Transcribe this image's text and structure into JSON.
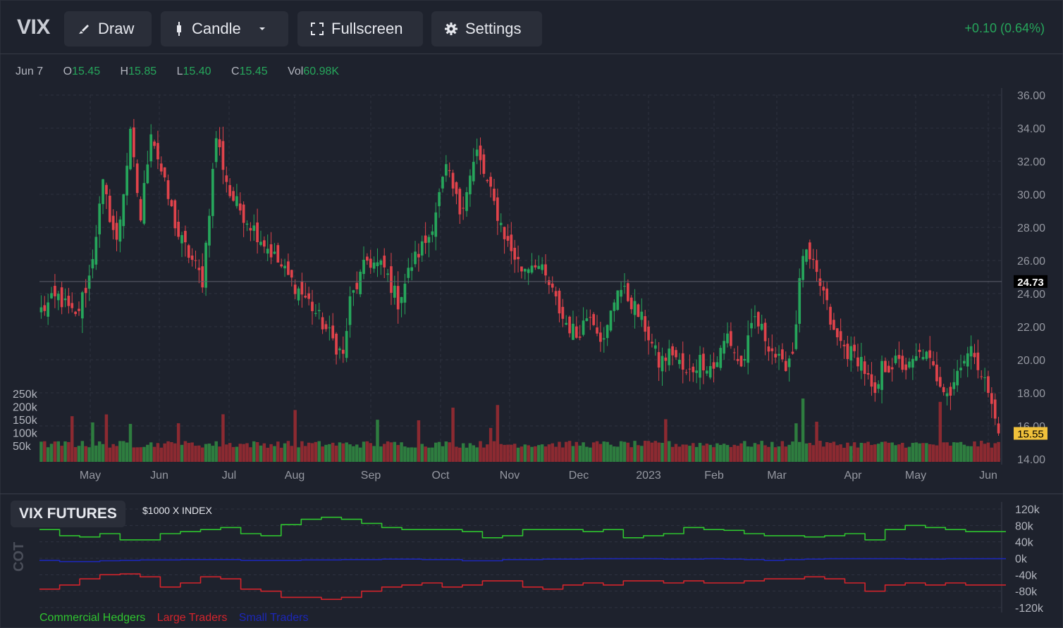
{
  "toolbar": {
    "symbol": "VIX",
    "draw_label": "Draw",
    "candle_label": "Candle",
    "fullscreen_label": "Fullscreen",
    "settings_label": "Settings",
    "change": "+0.10 (0.64%)"
  },
  "ohlc": {
    "date": "Jun 7",
    "open_key": "O",
    "open": "15.45",
    "high_key": "H",
    "high": "15.85",
    "low_key": "L",
    "low": "15.40",
    "close_key": "C",
    "close": "15.45",
    "vol_key": "Vol",
    "vol": "60.98K"
  },
  "colors": {
    "up": "#26a65b",
    "down": "#e0434b",
    "vol_up": "#2e7d3f",
    "vol_down": "#8c2a31",
    "commercial": "#2fc52f",
    "large": "#d3242c",
    "small": "#1c27b8",
    "last_price_bg": "#f0c13b",
    "crosshair_bg": "#000000"
  },
  "chart_data": [
    {
      "type": "candlestick",
      "title": "VIX",
      "x_labels": [
        "May",
        "Jun",
        "Jul",
        "Aug",
        "Sep",
        "Oct",
        "Nov",
        "Dec",
        "2023",
        "Feb",
        "Mar",
        "Apr",
        "May",
        "Jun"
      ],
      "ylim": [
        14,
        36
      ],
      "y_ticks": [
        "36.00",
        "34.00",
        "32.00",
        "30.00",
        "28.00",
        "26.00",
        "24.00",
        "22.00",
        "20.00",
        "18.00",
        "16.00",
        "14.00"
      ],
      "crosshair_value": "24.73",
      "last_price": "15.55",
      "anchors_close": [
        [
          0,
          23.0
        ],
        [
          5,
          23.8
        ],
        [
          10,
          22.5
        ],
        [
          14,
          25.0
        ],
        [
          18,
          30.5
        ],
        [
          22,
          27.0
        ],
        [
          26,
          33.5
        ],
        [
          29,
          28.5
        ],
        [
          32,
          34.0
        ],
        [
          36,
          30.5
        ],
        [
          40,
          27.5
        ],
        [
          44,
          26.0
        ],
        [
          47,
          24.8
        ],
        [
          51,
          33.5
        ],
        [
          55,
          30.0
        ],
        [
          60,
          28.5
        ],
        [
          66,
          26.8
        ],
        [
          72,
          25.0
        ],
        [
          78,
          23.5
        ],
        [
          84,
          21.5
        ],
        [
          88,
          20.2
        ],
        [
          90,
          23.5
        ],
        [
          95,
          26.0
        ],
        [
          100,
          25.5
        ],
        [
          104,
          23.5
        ],
        [
          108,
          25.8
        ],
        [
          113,
          27.5
        ],
        [
          118,
          31.5
        ],
        [
          122,
          29.0
        ],
        [
          127,
          32.5
        ],
        [
          131,
          30.0
        ],
        [
          136,
          27.0
        ],
        [
          140,
          25.5
        ],
        [
          144,
          26.0
        ],
        [
          148,
          24.5
        ],
        [
          152,
          22.5
        ],
        [
          156,
          21.5
        ],
        [
          160,
          23.0
        ],
        [
          164,
          21.0
        ],
        [
          168,
          24.5
        ],
        [
          172,
          23.5
        ],
        [
          176,
          22.0
        ],
        [
          180,
          19.8
        ],
        [
          184,
          20.5
        ],
        [
          188,
          19.0
        ],
        [
          192,
          20.0
        ],
        [
          196,
          19.5
        ],
        [
          200,
          21.5
        ],
        [
          204,
          19.5
        ],
        [
          208,
          22.5
        ],
        [
          212,
          21.0
        ],
        [
          216,
          19.5
        ],
        [
          219,
          20.5
        ],
        [
          222,
          26.5
        ],
        [
          225,
          25.5
        ],
        [
          228,
          24.0
        ],
        [
          231,
          21.5
        ],
        [
          235,
          20.5
        ],
        [
          239,
          20.0
        ],
        [
          243,
          17.5
        ],
        [
          245,
          19.5
        ],
        [
          249,
          19.8
        ],
        [
          253,
          19.5
        ],
        [
          257,
          20.5
        ],
        [
          261,
          19.0
        ],
        [
          265,
          18.0
        ],
        [
          268,
          20.0
        ],
        [
          272,
          20.5
        ],
        [
          276,
          18.0
        ],
        [
          279,
          15.55
        ]
      ],
      "volume_ticks": [
        "250k",
        "200k",
        "150k",
        "100k",
        "50k"
      ],
      "volume_spike_days": [
        9,
        15,
        19,
        26,
        40,
        53,
        74,
        98,
        110,
        120,
        131,
        133,
        182,
        220,
        222,
        226,
        262
      ]
    },
    {
      "type": "line",
      "title": "VIX FUTURES",
      "subtitle": "$1000 X INDEX",
      "y_axis_label": "COT",
      "ylim": [
        -120,
        120
      ],
      "y_ticks": [
        "120k",
        "80k",
        "40k",
        "0k",
        "-40k",
        "-80k",
        "-120k"
      ],
      "series": [
        {
          "name": "Commercial Hedgers",
          "values": [
            70,
            55,
            52,
            60,
            45,
            45,
            60,
            65,
            70,
            75,
            60,
            55,
            82,
            95,
            100,
            95,
            85,
            75,
            70,
            70,
            70,
            65,
            50,
            55,
            70,
            70,
            70,
            65,
            70,
            50,
            55,
            60,
            75,
            70,
            68,
            60,
            55,
            55,
            52,
            55,
            60,
            45,
            70,
            80,
            75,
            70,
            65,
            65
          ]
        },
        {
          "name": "Large Traders",
          "values": [
            -75,
            -65,
            -50,
            -40,
            -38,
            -45,
            -70,
            -60,
            -45,
            -50,
            -75,
            -80,
            -95,
            -95,
            -100,
            -95,
            -80,
            -70,
            -65,
            -60,
            -70,
            -65,
            -55,
            -55,
            -70,
            -75,
            -65,
            -60,
            -65,
            -55,
            -55,
            -60,
            -55,
            -60,
            -60,
            -55,
            -50,
            -50,
            -45,
            -50,
            -60,
            -80,
            -65,
            -60,
            -65,
            -60,
            -65,
            -65
          ]
        },
        {
          "name": "Small Traders",
          "values": [
            -5,
            -8,
            -8,
            -6,
            -5,
            -4,
            -4,
            -3,
            -3,
            -3,
            -5,
            -5,
            -5,
            -4,
            -4,
            -3,
            -3,
            -2,
            -2,
            -3,
            -3,
            -6,
            -6,
            -3,
            -3,
            -2,
            -2,
            -1,
            -1,
            -1,
            -1,
            -2,
            -2,
            -1,
            -2,
            -3,
            -5,
            -3,
            -2,
            -1,
            -1,
            -1,
            -1,
            -2,
            -2,
            -1,
            -1,
            -1
          ]
        }
      ]
    }
  ]
}
